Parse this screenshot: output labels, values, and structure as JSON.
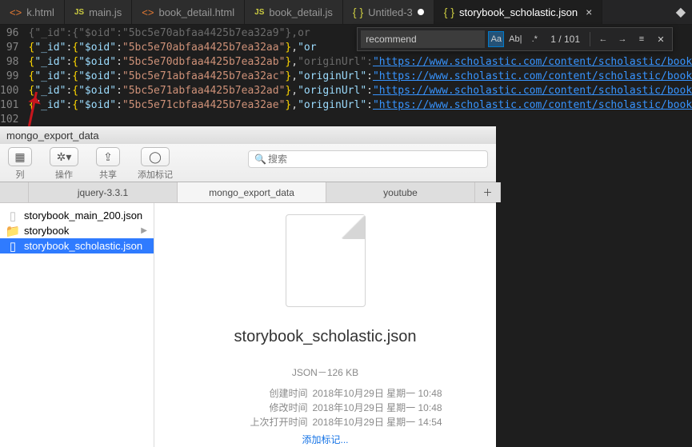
{
  "tabs": {
    "t0": "k.html",
    "t1": "main.js",
    "t2": "book_detail.html",
    "t3": "book_detail.js",
    "t4": "Untitled-3",
    "t5": "storybook_scholastic.json"
  },
  "find": {
    "value": "recommend",
    "count": "1 / 101",
    "aa": "Aa",
    "ab": "Ab|"
  },
  "gutter": {
    "l96": "96",
    "l97": "97",
    "l98": "98",
    "l99": "99",
    "l100": "100",
    "l101": "101",
    "l102": "102"
  },
  "code": {
    "idkey": "\"_id\"",
    "oidkey": "\"$oid\"",
    "originkey_dim": "\"originUrl\"",
    "originkey": "\"originUrl\"",
    "oid96": "\"5bc5e70abfaa4425b7ea32a9\"",
    "oid97": "\"5bc5e70abfaa4425b7ea32aa\"",
    "oid98": "\"5bc5e70dbfaa4425b7ea32ab\"",
    "oid99": "\"5bc5e71abfaa4425b7ea32ac\"",
    "oid100": "\"5bc5e71abfaa4425b7ea32ad\"",
    "oid101": "\"5bc5e71cbfaa4425b7ea32ae\"",
    "url_full": "\"https://www.scholastic.com/content/scholastic/book",
    "or_dim": "\"or",
    "or_tail": "or",
    "ok_tail": "ok"
  },
  "finder": {
    "title": "mongo_export_data",
    "toolbar": {
      "arrange": "列",
      "action": "操作",
      "share": "共享",
      "tag": "添加标记",
      "search_placeholder": "搜索"
    },
    "tabs": {
      "jquery": "jquery-3.3.1",
      "mongo": "mongo_export_data",
      "youtube": "youtube"
    },
    "side": {
      "f1": "storybook_main_200.json",
      "f2": "storybook",
      "f3": "storybook_scholastic.json"
    },
    "preview": {
      "name": "storybook_scholastic.json",
      "kind": "JSON－126 KB",
      "labels": {
        "created": "创建时间",
        "modified": "修改时间",
        "opened": "上次打开时间"
      },
      "created": "2018年10月29日 星期一 10:48",
      "modified": "2018年10月29日 星期一 10:48",
      "opened": "2018年10月29日 星期一 14:54",
      "addtag": "添加标记..."
    }
  }
}
